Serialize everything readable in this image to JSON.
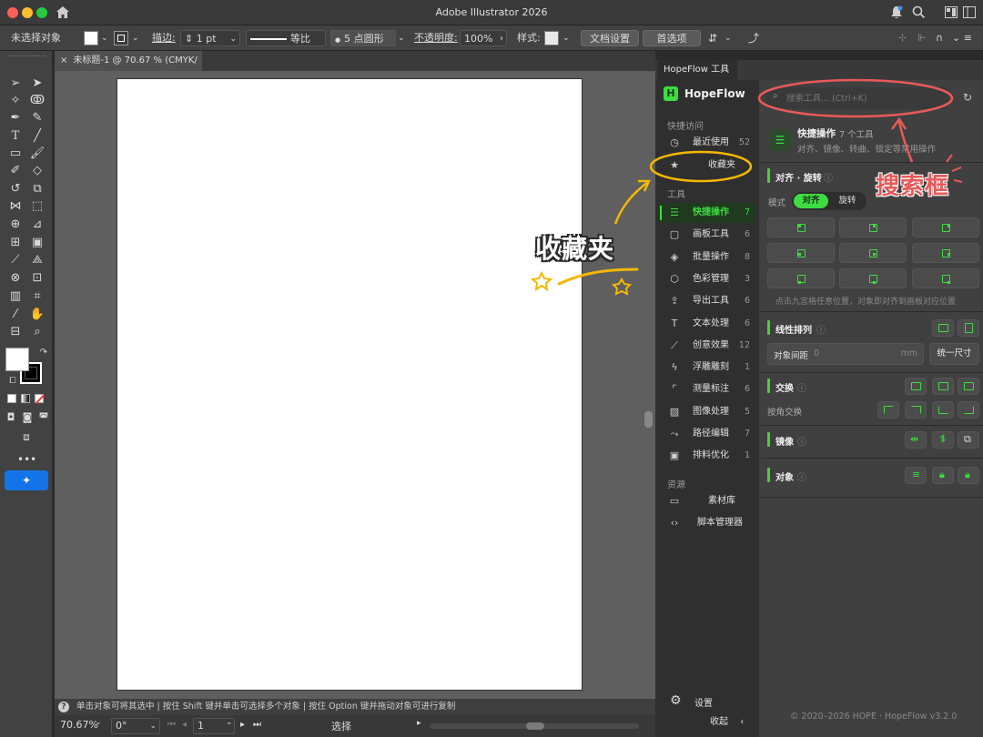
{
  "window": {
    "title": "Adobe Illustrator 2026"
  },
  "control_bar": {
    "selection": "未选择对象",
    "stroke_label": "描边:",
    "stroke_value": "1 pt",
    "profile": "等比",
    "brush": "5 点圆形",
    "opacity_label": "不透明度:",
    "opacity_value": "100%",
    "style_label": "样式:",
    "doc_settings": "文档设置",
    "preferences": "首选项"
  },
  "document": {
    "tab_title": "未标题-1 @ 70.67 % (CMYK/预览)",
    "hint": "单击对象可将其选中 | 按住 Shift 键并单击可选择多个对象 | 按住 Option 键并拖动对象可进行复制",
    "zoom": "70.67%",
    "rotation": "0°",
    "artboard": "1",
    "tool_status": "选择"
  },
  "panel": {
    "tab": "HopeFlow 工具箱",
    "brand": "HopeFlow",
    "brand_icon": "H",
    "search_placeholder": "搜索工具... (Ctrl+K)",
    "quick_access_heading": "快捷访问",
    "quick_access": [
      {
        "label": "最近使用",
        "count": "52",
        "icon": "clock-icon"
      },
      {
        "label": "收藏夹",
        "count": "",
        "icon": "star-icon"
      }
    ],
    "tools_heading": "工具",
    "tools": [
      {
        "label": "快捷操作",
        "count": "7",
        "icon": "menu-lines-icon",
        "active": true
      },
      {
        "label": "画板工具",
        "count": "6",
        "icon": "artboard-icon"
      },
      {
        "label": "批量操作",
        "count": "8",
        "icon": "layers-icon"
      },
      {
        "label": "色彩管理",
        "count": "3",
        "icon": "cube-icon"
      },
      {
        "label": "导出工具",
        "count": "6",
        "icon": "export-icon"
      },
      {
        "label": "文本处理",
        "count": "6",
        "icon": "text-icon"
      },
      {
        "label": "创意效果",
        "count": "12",
        "icon": "magic-wand-icon"
      },
      {
        "label": "浮雕雕刻",
        "count": "1",
        "icon": "lightning-icon"
      },
      {
        "label": "测量标注",
        "count": "6",
        "icon": "measure-icon"
      },
      {
        "label": "图像处理",
        "count": "5",
        "icon": "image-icon"
      },
      {
        "label": "路径编辑",
        "count": "7",
        "icon": "path-icon"
      },
      {
        "label": "排料优化",
        "count": "1",
        "icon": "nest-icon"
      }
    ],
    "resources_heading": "资源",
    "resources": [
      {
        "label": "素材库",
        "icon": "folder-icon"
      },
      {
        "label": "脚本管理器",
        "icon": "code-icon"
      }
    ],
    "settings": "设置",
    "collapse": "收起",
    "footer": "© 2020–2026 HOPE · HopeFlow v3.2.0",
    "category": {
      "title": "快捷操作",
      "count": "7 个工具",
      "desc": "对齐、镜像、转曲、锁定等常用操作"
    },
    "align_section": {
      "title": "对齐 · 旋转",
      "mode_label": "模式",
      "mode_options": [
        "对齐",
        "旋转"
      ],
      "selected_mode": "对齐",
      "hint": "点击九宫格任意位置，对象即对齐到画板对应位置"
    },
    "linear_section": {
      "title": "线性排列",
      "spacing_label": "对象间距",
      "spacing_value": "0",
      "unit": "mm",
      "unify_btn": "统一尺寸"
    },
    "swap_section": {
      "title": "交换",
      "corner_label": "按角交换"
    },
    "mirror_section": {
      "title": "镜像"
    },
    "object_section": {
      "title": "对象"
    }
  },
  "annotations": {
    "search_box": "搜索框",
    "favorites": "收藏夹"
  },
  "colors": {
    "accent": "#3ddc40",
    "annotation_red": "#e85a5a",
    "annotation_yellow": "#f5b800"
  }
}
